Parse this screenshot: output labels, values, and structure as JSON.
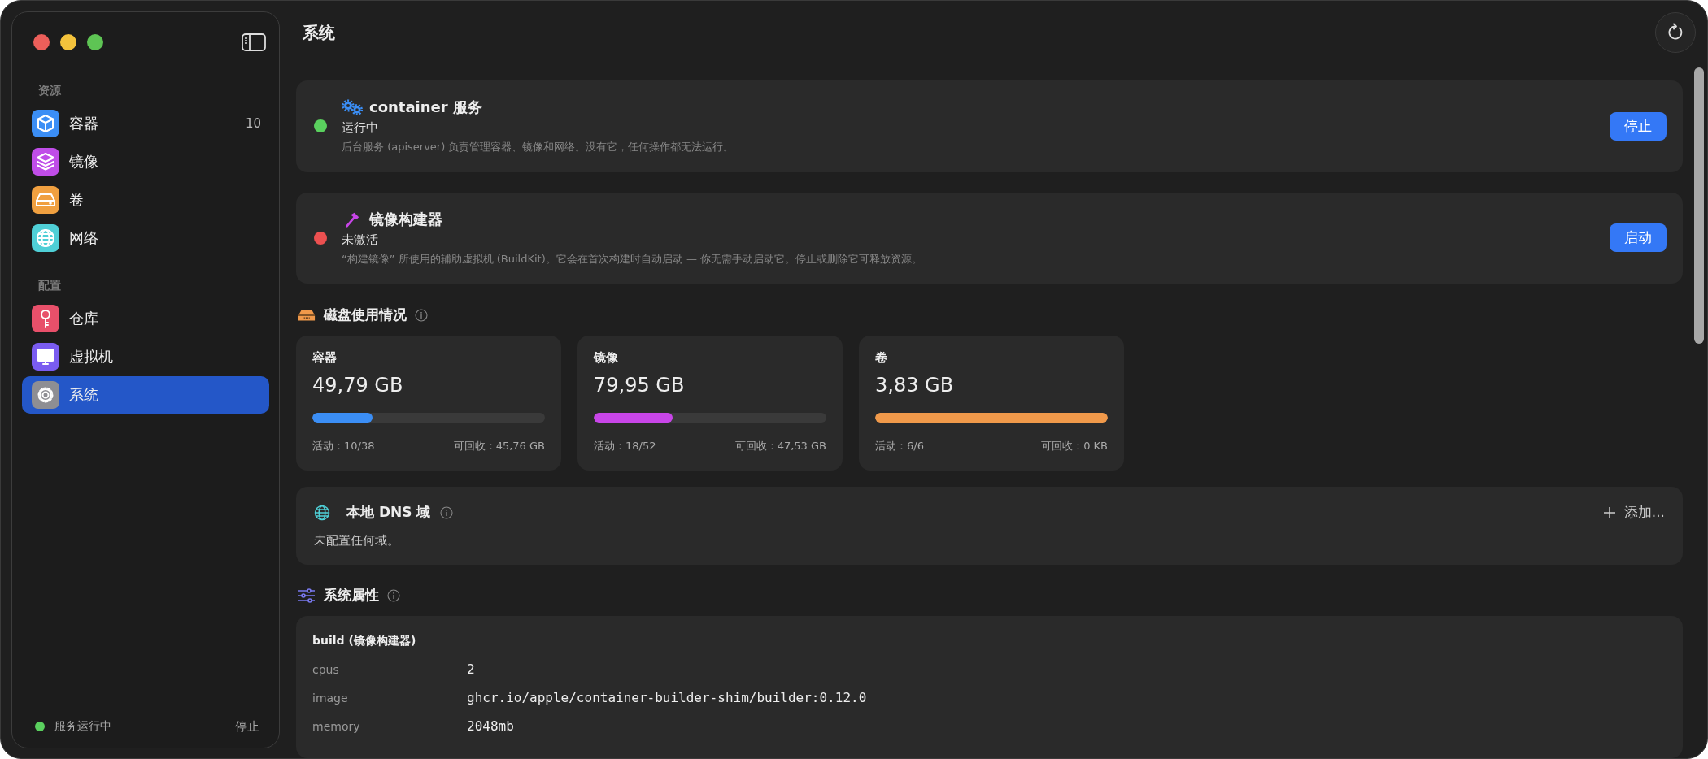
{
  "sidebar": {
    "sections": [
      {
        "title": "资源",
        "items": [
          {
            "label": "容器",
            "kind": "cube",
            "color": "#3b8ef5",
            "badge": "10",
            "selected": false
          },
          {
            "label": "镜像",
            "kind": "layers",
            "color": "#c04de8",
            "selected": false
          },
          {
            "label": "卷",
            "kind": "drive",
            "color": "#f0a040",
            "selected": false
          },
          {
            "label": "网络",
            "kind": "globe",
            "color": "#4fcfd6",
            "selected": false
          }
        ]
      },
      {
        "title": "配置",
        "items": [
          {
            "label": "仓库",
            "kind": "key",
            "color": "#e8506a",
            "selected": false
          },
          {
            "label": "虚拟机",
            "kind": "display",
            "color": "#7a5cf0",
            "selected": false
          },
          {
            "label": "系统",
            "kind": "gear",
            "color": "#8e8e93",
            "selected": true
          }
        ]
      }
    ],
    "footer": {
      "status": "服务运行中",
      "color": "#5ad05e",
      "action": "停止"
    }
  },
  "page": {
    "title": "系统"
  },
  "services": [
    {
      "kind": "gears",
      "title": "container 服务",
      "status": "运行中",
      "color": "#5ad05e",
      "description": "后台服务 (apiserver) 负责管理容器、镜像和网络。没有它，任何操作都无法运行。",
      "action": "停止"
    },
    {
      "kind": "hammer",
      "title": "镜像构建器",
      "status": "未激活",
      "color": "#ec5050",
      "description": "“构建镜像” 所使用的辅助虚拟机 (BuildKit)。它会在首次构建时自动启动 — 你无需手动启动它。停止或删除它可释放资源。",
      "action": "启动"
    }
  ],
  "disk_usage": {
    "title": "磁盘使用情况",
    "cards": [
      {
        "label": "容器",
        "value": "49,79 GB",
        "level": 0.26,
        "color": "#3b8ef5",
        "active": "活动：10/38",
        "reclaimable": "可回收：45,76 GB"
      },
      {
        "label": "镜像",
        "value": "79,95 GB",
        "level": 0.34,
        "color": "#c845e8",
        "active": "活动：18/52",
        "reclaimable": "可回收：47,53 GB"
      },
      {
        "label": "卷",
        "value": "3,83 GB",
        "level": 1,
        "color": "#f0994a",
        "active": "活动：6/6",
        "reclaimable": "可回收：0 KB"
      }
    ]
  },
  "dns": {
    "title": "本地 DNS 域",
    "empty": "未配置任何域。",
    "add": "添加..."
  },
  "properties": {
    "title": "系统属性",
    "groups": [
      {
        "title": "build (镜像构建器)",
        "rows": [
          {
            "key": "cpus",
            "value": "2"
          },
          {
            "key": "image",
            "value": "ghcr.io/apple/container-builder-shim/builder:0.12.0"
          },
          {
            "key": "memory",
            "value": "2048mb"
          }
        ]
      }
    ]
  }
}
